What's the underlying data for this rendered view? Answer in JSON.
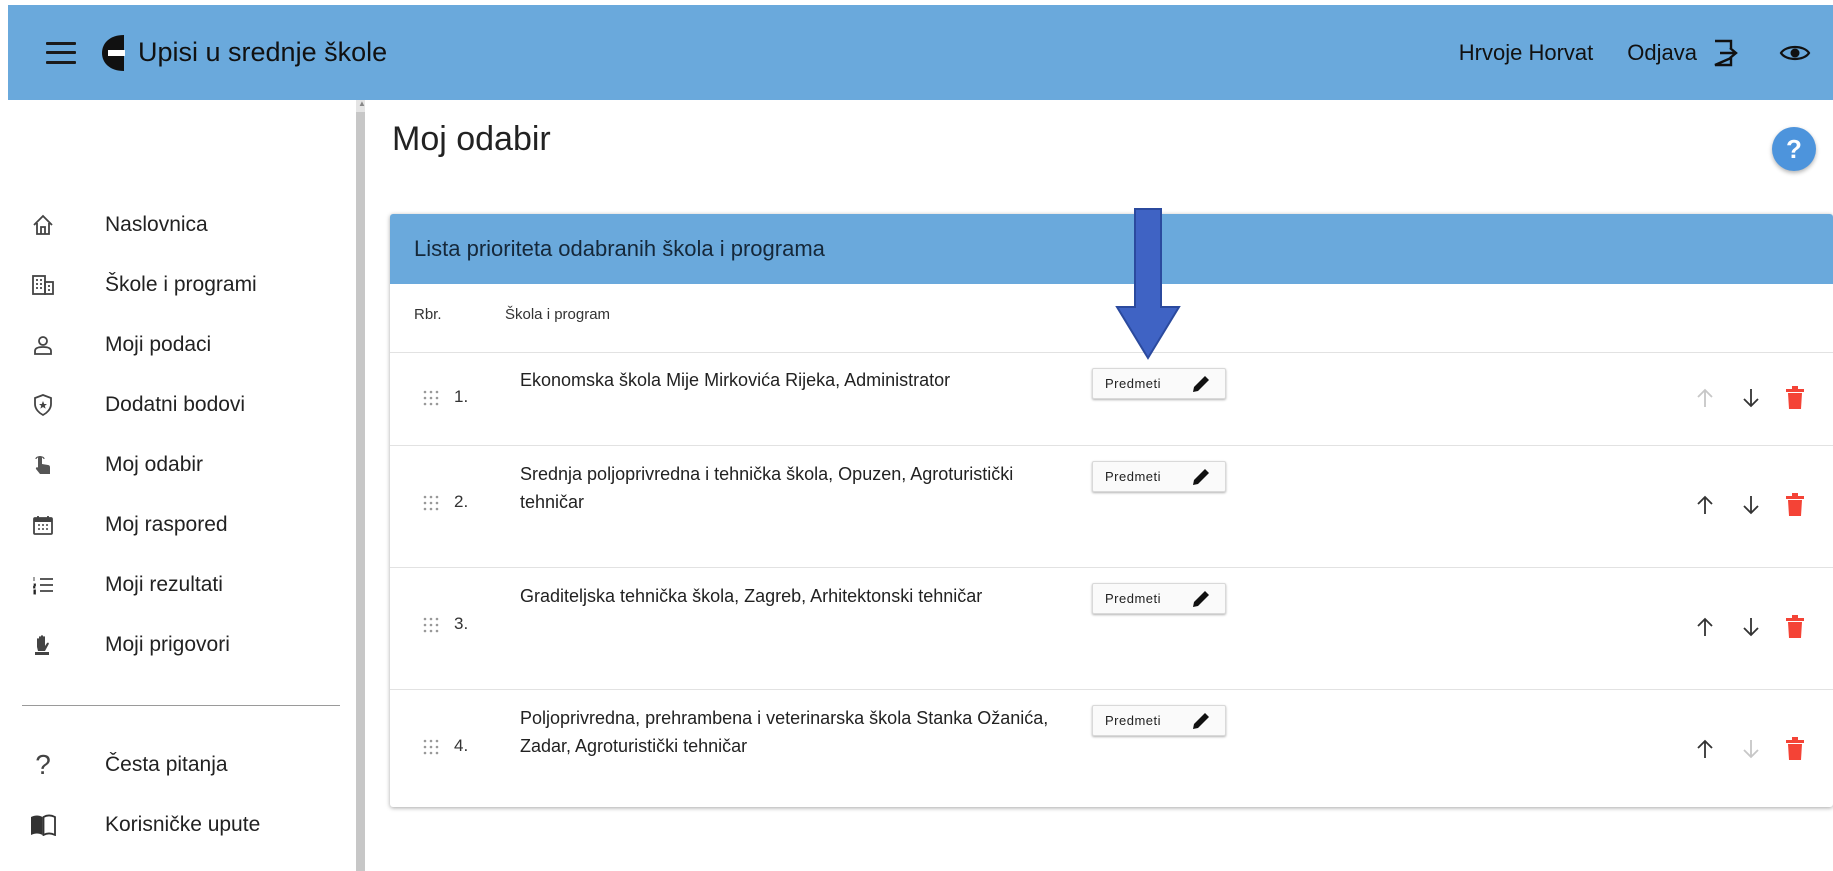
{
  "header": {
    "app_title": "Upisi u srednje škole",
    "user_name": "Hrvoje Horvat",
    "logout_label": "Odjava",
    "bar_color": "#6aa9dc"
  },
  "sidebar": {
    "items": [
      {
        "label": "Naslovnica",
        "icon": "home-icon"
      },
      {
        "label": "Škole i programi",
        "icon": "building-icon"
      },
      {
        "label": "Moji podaci",
        "icon": "person-icon"
      },
      {
        "label": "Dodatni bodovi",
        "icon": "shield-star-icon"
      },
      {
        "label": "Moj odabir",
        "icon": "hand-pointer-icon"
      },
      {
        "label": "Moj raspored",
        "icon": "calendar-icon"
      },
      {
        "label": "Moji rezultati",
        "icon": "numbered-list-icon"
      },
      {
        "label": "Moji prigovori",
        "icon": "raised-hand-icon"
      },
      {
        "label": "Česta pitanja",
        "icon": "question-icon"
      },
      {
        "label": "Korisničke upute",
        "icon": "book-icon"
      }
    ]
  },
  "main": {
    "page_title": "Moj odabir",
    "help_label": "?",
    "card_title": "Lista prioriteta odabranih škola i programa",
    "columns": {
      "rbr": "Rbr.",
      "school": "Škola i program"
    },
    "predmeti_label": "Predmeti",
    "rows": [
      {
        "rbr": "1.",
        "name": "Ekonomska škola Mije Mirkovića Rijeka, Administrator",
        "up_enabled": false,
        "down_enabled": true
      },
      {
        "rbr": "2.",
        "name": "Srednja poljoprivredna i tehnička škola, Opuzen, Agroturistički tehničar",
        "up_enabled": true,
        "down_enabled": true
      },
      {
        "rbr": "3.",
        "name": "Graditeljska tehnička škola, Zagreb, Arhitektonski tehničar",
        "up_enabled": true,
        "down_enabled": true
      },
      {
        "rbr": "4.",
        "name": "Poljoprivredna, prehrambena i veterinarska škola Stanka Ožanića, Zadar, Agroturistički tehničar",
        "up_enabled": true,
        "down_enabled": false
      }
    ]
  },
  "colors": {
    "accent": "#6aa9dc",
    "help_button": "#4d94dc",
    "delete": "#f44336",
    "annotation_arrow": "#3f63c4"
  }
}
